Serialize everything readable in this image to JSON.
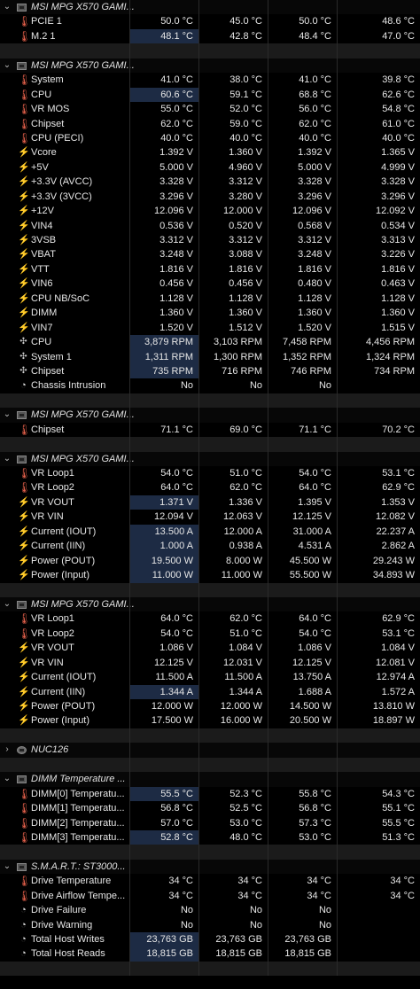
{
  "rows": [
    {
      "type": "group",
      "label": "MSI MPG X570 GAMI...",
      "icon": "motherboard-icon",
      "expander": "⌄"
    },
    {
      "type": "sensor",
      "icon": "temp",
      "label": "PCIE 1",
      "values": [
        "50.0 °C",
        "45.0 °C",
        "50.0 °C",
        "48.6 °C"
      ]
    },
    {
      "type": "sensor",
      "icon": "temp",
      "label": "M.2 1",
      "values": [
        "48.1 °C",
        "42.8 °C",
        "48.4 °C",
        "47.0 °C"
      ],
      "hl": [
        0
      ]
    },
    {
      "type": "blank"
    },
    {
      "type": "group",
      "label": "MSI MPG X570 GAMI...",
      "icon": "motherboard-icon",
      "expander": "⌄"
    },
    {
      "type": "sensor",
      "icon": "temp",
      "label": "System",
      "values": [
        "41.0 °C",
        "38.0 °C",
        "41.0 °C",
        "39.8 °C"
      ]
    },
    {
      "type": "sensor",
      "icon": "temp",
      "label": "CPU",
      "values": [
        "60.6 °C",
        "59.1 °C",
        "68.8 °C",
        "62.6 °C"
      ],
      "hl": [
        0
      ]
    },
    {
      "type": "sensor",
      "icon": "temp",
      "label": "VR MOS",
      "values": [
        "55.0 °C",
        "52.0 °C",
        "56.0 °C",
        "54.8 °C"
      ]
    },
    {
      "type": "sensor",
      "icon": "temp",
      "label": "Chipset",
      "values": [
        "62.0 °C",
        "59.0 °C",
        "62.0 °C",
        "61.0 °C"
      ]
    },
    {
      "type": "sensor",
      "icon": "temp",
      "label": "CPU (PECI)",
      "values": [
        "40.0 °C",
        "40.0 °C",
        "40.0 °C",
        "40.0 °C"
      ]
    },
    {
      "type": "sensor",
      "icon": "volt",
      "label": "Vcore",
      "values": [
        "1.392 V",
        "1.360 V",
        "1.392 V",
        "1.365 V"
      ]
    },
    {
      "type": "sensor",
      "icon": "volt",
      "label": "+5V",
      "values": [
        "5.000 V",
        "4.960 V",
        "5.000 V",
        "4.999 V"
      ]
    },
    {
      "type": "sensor",
      "icon": "volt",
      "label": "+3.3V (AVCC)",
      "values": [
        "3.328 V",
        "3.312 V",
        "3.328 V",
        "3.328 V"
      ]
    },
    {
      "type": "sensor",
      "icon": "volt",
      "label": "+3.3V (3VCC)",
      "values": [
        "3.296 V",
        "3.280 V",
        "3.296 V",
        "3.296 V"
      ]
    },
    {
      "type": "sensor",
      "icon": "volt",
      "label": "+12V",
      "values": [
        "12.096 V",
        "12.000 V",
        "12.096 V",
        "12.092 V"
      ]
    },
    {
      "type": "sensor",
      "icon": "volt",
      "label": "VIN4",
      "values": [
        "0.536 V",
        "0.520 V",
        "0.568 V",
        "0.534 V"
      ]
    },
    {
      "type": "sensor",
      "icon": "volt",
      "label": "3VSB",
      "values": [
        "3.312 V",
        "3.312 V",
        "3.312 V",
        "3.313 V"
      ]
    },
    {
      "type": "sensor",
      "icon": "volt",
      "label": "VBAT",
      "values": [
        "3.248 V",
        "3.088 V",
        "3.248 V",
        "3.226 V"
      ]
    },
    {
      "type": "sensor",
      "icon": "volt",
      "label": "VTT",
      "values": [
        "1.816 V",
        "1.816 V",
        "1.816 V",
        "1.816 V"
      ]
    },
    {
      "type": "sensor",
      "icon": "volt",
      "label": "VIN6",
      "values": [
        "0.456 V",
        "0.456 V",
        "0.480 V",
        "0.463 V"
      ]
    },
    {
      "type": "sensor",
      "icon": "volt",
      "label": "CPU NB/SoC",
      "values": [
        "1.128 V",
        "1.128 V",
        "1.128 V",
        "1.128 V"
      ]
    },
    {
      "type": "sensor",
      "icon": "volt",
      "label": "DIMM",
      "values": [
        "1.360 V",
        "1.360 V",
        "1.360 V",
        "1.360 V"
      ]
    },
    {
      "type": "sensor",
      "icon": "volt",
      "label": "VIN7",
      "values": [
        "1.520 V",
        "1.512 V",
        "1.520 V",
        "1.515 V"
      ]
    },
    {
      "type": "sensor",
      "icon": "fan",
      "label": "CPU",
      "values": [
        "3,879 RPM",
        "3,103 RPM",
        "7,458 RPM",
        "4,456 RPM"
      ],
      "hl": [
        0
      ]
    },
    {
      "type": "sensor",
      "icon": "fan",
      "label": "System 1",
      "values": [
        "1,311 RPM",
        "1,300 RPM",
        "1,352 RPM",
        "1,324 RPM"
      ],
      "hl": [
        0
      ]
    },
    {
      "type": "sensor",
      "icon": "fan",
      "label": "Chipset",
      "values": [
        "735 RPM",
        "716 RPM",
        "746 RPM",
        "734 RPM"
      ],
      "hl": [
        0
      ]
    },
    {
      "type": "sensor",
      "icon": "circle",
      "label": "Chassis Intrusion",
      "values": [
        "No",
        "No",
        "No",
        ""
      ]
    },
    {
      "type": "blank"
    },
    {
      "type": "group",
      "label": "MSI MPG X570 GAMI...",
      "icon": "motherboard-icon",
      "expander": "⌄"
    },
    {
      "type": "sensor",
      "icon": "temp",
      "label": "Chipset",
      "values": [
        "71.1 °C",
        "69.0 °C",
        "71.1 °C",
        "70.2 °C"
      ]
    },
    {
      "type": "blank"
    },
    {
      "type": "group",
      "label": "MSI MPG X570 GAMI...",
      "icon": "motherboard-icon",
      "expander": "⌄"
    },
    {
      "type": "sensor",
      "icon": "temp",
      "label": "VR Loop1",
      "values": [
        "54.0 °C",
        "51.0 °C",
        "54.0 °C",
        "53.1 °C"
      ]
    },
    {
      "type": "sensor",
      "icon": "temp",
      "label": "VR Loop2",
      "values": [
        "64.0 °C",
        "62.0 °C",
        "64.0 °C",
        "62.9 °C"
      ]
    },
    {
      "type": "sensor",
      "icon": "volt",
      "label": "VR VOUT",
      "values": [
        "1.371 V",
        "1.336 V",
        "1.395 V",
        "1.353 V"
      ],
      "hl": [
        0
      ]
    },
    {
      "type": "sensor",
      "icon": "volt",
      "label": "VR VIN",
      "values": [
        "12.094 V",
        "12.063 V",
        "12.125 V",
        "12.082 V"
      ]
    },
    {
      "type": "sensor",
      "icon": "volt",
      "label": "Current (IOUT)",
      "values": [
        "13.500 A",
        "12.000 A",
        "31.000 A",
        "22.237 A"
      ],
      "hl": [
        0
      ]
    },
    {
      "type": "sensor",
      "icon": "volt",
      "label": "Current (IIN)",
      "values": [
        "1.000 A",
        "0.938 A",
        "4.531 A",
        "2.862 A"
      ],
      "hl": [
        0
      ]
    },
    {
      "type": "sensor",
      "icon": "volt",
      "label": "Power (POUT)",
      "values": [
        "19.500 W",
        "8.000 W",
        "45.500 W",
        "29.243 W"
      ],
      "hl": [
        0
      ]
    },
    {
      "type": "sensor",
      "icon": "volt",
      "label": "Power (Input)",
      "values": [
        "11.000 W",
        "11.000 W",
        "55.500 W",
        "34.893 W"
      ],
      "hl": [
        0
      ]
    },
    {
      "type": "blank"
    },
    {
      "type": "group",
      "label": "MSI MPG X570 GAMI...",
      "icon": "motherboard-icon",
      "expander": "⌄"
    },
    {
      "type": "sensor",
      "icon": "temp",
      "label": "VR Loop1",
      "values": [
        "64.0 °C",
        "62.0 °C",
        "64.0 °C",
        "62.9 °C"
      ]
    },
    {
      "type": "sensor",
      "icon": "temp",
      "label": "VR Loop2",
      "values": [
        "54.0 °C",
        "51.0 °C",
        "54.0 °C",
        "53.1 °C"
      ]
    },
    {
      "type": "sensor",
      "icon": "volt",
      "label": "VR VOUT",
      "values": [
        "1.086 V",
        "1.084 V",
        "1.086 V",
        "1.084 V"
      ]
    },
    {
      "type": "sensor",
      "icon": "volt",
      "label": "VR VIN",
      "values": [
        "12.125 V",
        "12.031 V",
        "12.125 V",
        "12.081 V"
      ]
    },
    {
      "type": "sensor",
      "icon": "volt",
      "label": "Current (IOUT)",
      "values": [
        "11.500 A",
        "11.500 A",
        "13.750 A",
        "12.974 A"
      ]
    },
    {
      "type": "sensor",
      "icon": "volt",
      "label": "Current (IIN)",
      "values": [
        "1.344 A",
        "1.344 A",
        "1.688 A",
        "1.572 A"
      ],
      "hl": [
        0
      ]
    },
    {
      "type": "sensor",
      "icon": "volt",
      "label": "Power (POUT)",
      "values": [
        "12.000 W",
        "12.000 W",
        "14.500 W",
        "13.810 W"
      ]
    },
    {
      "type": "sensor",
      "icon": "volt",
      "label": "Power (Input)",
      "values": [
        "17.500 W",
        "16.000 W",
        "20.500 W",
        "18.897 W"
      ]
    },
    {
      "type": "blank"
    },
    {
      "type": "group",
      "label": "NUC126",
      "icon": "chip-icon",
      "expander": "›"
    },
    {
      "type": "blank"
    },
    {
      "type": "group",
      "label": "DIMM Temperature ...",
      "icon": "memory-icon",
      "expander": "⌄"
    },
    {
      "type": "sensor",
      "icon": "temp",
      "label": "DIMM[0] Temperatu...",
      "values": [
        "55.5 °C",
        "52.3 °C",
        "55.8 °C",
        "54.3 °C"
      ],
      "hl": [
        0
      ]
    },
    {
      "type": "sensor",
      "icon": "temp",
      "label": "DIMM[1] Temperatu...",
      "values": [
        "56.8 °C",
        "52.5 °C",
        "56.8 °C",
        "55.1 °C"
      ]
    },
    {
      "type": "sensor",
      "icon": "temp",
      "label": "DIMM[2] Temperatu...",
      "values": [
        "57.0 °C",
        "53.0 °C",
        "57.3 °C",
        "55.5 °C"
      ]
    },
    {
      "type": "sensor",
      "icon": "temp",
      "label": "DIMM[3] Temperatu...",
      "values": [
        "52.8 °C",
        "48.0 °C",
        "53.0 °C",
        "51.3 °C"
      ],
      "hl": [
        0
      ]
    },
    {
      "type": "blank"
    },
    {
      "type": "group",
      "label": "S.M.A.R.T.: ST3000...",
      "icon": "drive-icon",
      "expander": "⌄"
    },
    {
      "type": "sensor",
      "icon": "temp",
      "label": "Drive Temperature",
      "values": [
        "34 °C",
        "34 °C",
        "34 °C",
        "34 °C"
      ]
    },
    {
      "type": "sensor",
      "icon": "temp",
      "label": "Drive Airflow Tempe...",
      "values": [
        "34 °C",
        "34 °C",
        "34 °C",
        "34 °C"
      ]
    },
    {
      "type": "sensor",
      "icon": "circle",
      "label": "Drive Failure",
      "values": [
        "No",
        "No",
        "No",
        ""
      ]
    },
    {
      "type": "sensor",
      "icon": "circle",
      "label": "Drive Warning",
      "values": [
        "No",
        "No",
        "No",
        ""
      ]
    },
    {
      "type": "sensor",
      "icon": "circle",
      "label": "Total Host Writes",
      "values": [
        "23,763 GB",
        "23,763 GB",
        "23,763 GB",
        ""
      ],
      "hl": [
        0
      ]
    },
    {
      "type": "sensor",
      "icon": "circle",
      "label": "Total Host Reads",
      "values": [
        "18,815 GB",
        "18,815 GB",
        "18,815 GB",
        ""
      ],
      "hl": [
        0
      ]
    },
    {
      "type": "blank"
    }
  ]
}
